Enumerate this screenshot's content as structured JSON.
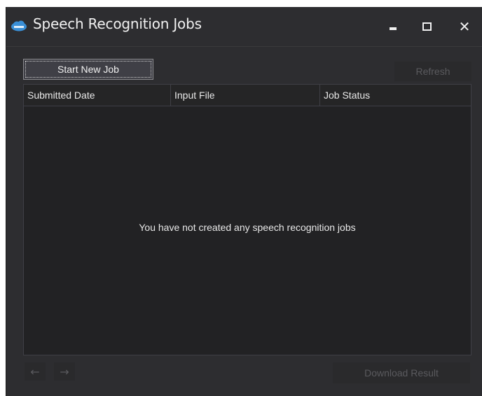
{
  "window": {
    "title": "Speech Recognition Jobs",
    "controls": {
      "minimize_icon": "minimize-icon",
      "maximize_icon": "maximize-icon",
      "close_label": "✕"
    }
  },
  "toolbar": {
    "start_label": "Start New Job",
    "refresh_label": "Refresh"
  },
  "table": {
    "columns": [
      "Submitted Date",
      "Input File",
      "Job Status"
    ],
    "rows": [],
    "empty_message": "You have not created any speech recognition jobs"
  },
  "footer": {
    "back_arrow": "←",
    "forward_arrow": "→",
    "download_label": "Download Result"
  },
  "colors": {
    "window_bg": "#2d2d30",
    "grid_bg": "#222224",
    "text": "#f1f1f1",
    "disabled_text": "#5a5a5e",
    "app_icon_accent": "#3a8fd6"
  }
}
